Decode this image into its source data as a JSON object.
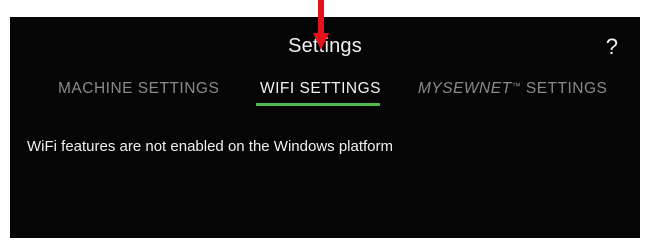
{
  "header": {
    "title": "Settings",
    "help_label": "?"
  },
  "tabs": [
    {
      "label": "MACHINE SETTINGS",
      "active": false
    },
    {
      "label": "WIFI SETTINGS",
      "active": true
    },
    {
      "brand": "MYSEWNET",
      "tm": "™",
      "label_suffix": " SETTINGS",
      "active": false
    }
  ],
  "main": {
    "message": "WiFi features are not enabled on the Windows platform"
  },
  "colors": {
    "background": "#050505",
    "active_tab_underline": "#4fb84a",
    "annotation_arrow": "#e3121b",
    "inactive_tab_text": "#8a8a8a"
  },
  "annotation": {
    "icon": "down-arrow-icon"
  }
}
